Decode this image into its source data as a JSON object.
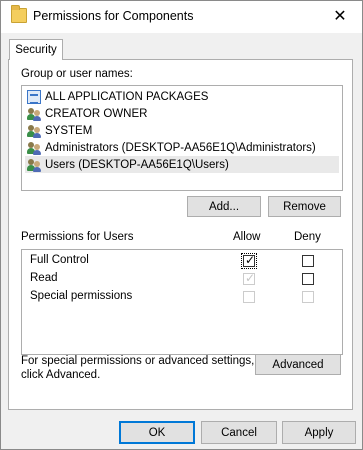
{
  "window": {
    "title": "Permissions for Components",
    "close_glyph": "✕"
  },
  "tab": {
    "label": "Security"
  },
  "group_list": {
    "label": "Group or user names:",
    "items": [
      {
        "label": "ALL APPLICATION PACKAGES",
        "icon": "app-packages-icon"
      },
      {
        "label": "CREATOR OWNER",
        "icon": "users-icon"
      },
      {
        "label": "SYSTEM",
        "icon": "users-icon"
      },
      {
        "label": "Administrators (DESKTOP-AA56E1Q\\Administrators)",
        "icon": "users-icon"
      },
      {
        "label": "Users (DESKTOP-AA56E1Q\\Users)",
        "icon": "users-icon",
        "selected": true
      }
    ]
  },
  "buttons": {
    "add": "Add...",
    "remove": "Remove",
    "advanced": "Advanced",
    "ok": "OK",
    "cancel": "Cancel",
    "apply": "Apply"
  },
  "permissions": {
    "label": "Permissions for Users",
    "allow_header": "Allow",
    "deny_header": "Deny",
    "rows": [
      {
        "name": "Full Control",
        "allow": true,
        "allow_enabled": true,
        "deny": false,
        "deny_enabled": true
      },
      {
        "name": "Read",
        "allow": true,
        "allow_enabled": false,
        "deny": false,
        "deny_enabled": true
      },
      {
        "name": "Special permissions",
        "allow": false,
        "allow_enabled": false,
        "deny": false,
        "deny_enabled": false
      }
    ]
  },
  "advanced_hint": {
    "line1": "For special permissions or advanced settings,",
    "line2": "click Advanced."
  },
  "colors": {
    "focus_border": "#0078d7",
    "selection_bg": "#e9e9e9",
    "dialog_bg": "#f0f0f0"
  }
}
